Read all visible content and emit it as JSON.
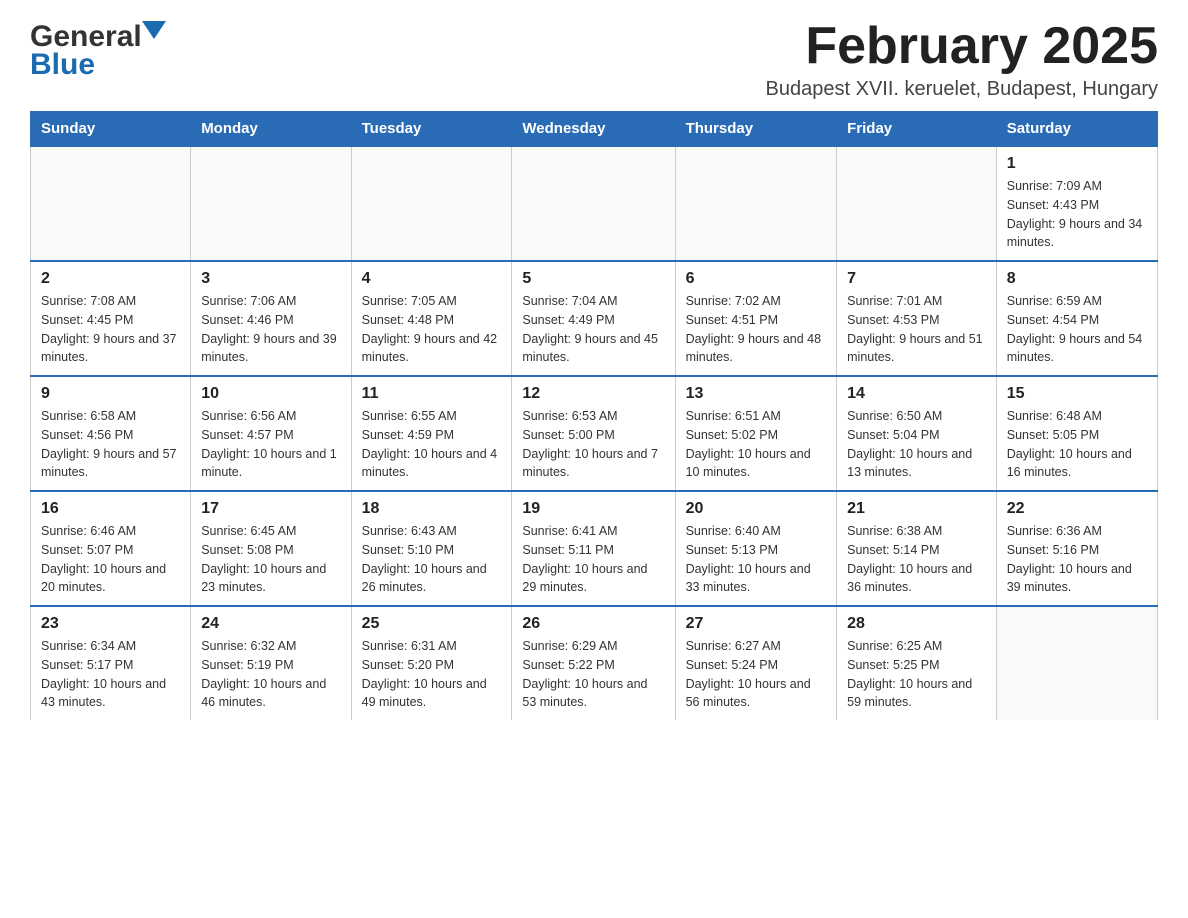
{
  "logo": {
    "general": "General",
    "blue": "Blue"
  },
  "header": {
    "month": "February 2025",
    "location": "Budapest XVII. keruelet, Budapest, Hungary"
  },
  "days_of_week": [
    "Sunday",
    "Monday",
    "Tuesday",
    "Wednesday",
    "Thursday",
    "Friday",
    "Saturday"
  ],
  "weeks": [
    [
      {
        "day": "",
        "sunrise": "",
        "sunset": "",
        "daylight": ""
      },
      {
        "day": "",
        "sunrise": "",
        "sunset": "",
        "daylight": ""
      },
      {
        "day": "",
        "sunrise": "",
        "sunset": "",
        "daylight": ""
      },
      {
        "day": "",
        "sunrise": "",
        "sunset": "",
        "daylight": ""
      },
      {
        "day": "",
        "sunrise": "",
        "sunset": "",
        "daylight": ""
      },
      {
        "day": "",
        "sunrise": "",
        "sunset": "",
        "daylight": ""
      },
      {
        "day": "1",
        "sunrise": "Sunrise: 7:09 AM",
        "sunset": "Sunset: 4:43 PM",
        "daylight": "Daylight: 9 hours and 34 minutes."
      }
    ],
    [
      {
        "day": "2",
        "sunrise": "Sunrise: 7:08 AM",
        "sunset": "Sunset: 4:45 PM",
        "daylight": "Daylight: 9 hours and 37 minutes."
      },
      {
        "day": "3",
        "sunrise": "Sunrise: 7:06 AM",
        "sunset": "Sunset: 4:46 PM",
        "daylight": "Daylight: 9 hours and 39 minutes."
      },
      {
        "day": "4",
        "sunrise": "Sunrise: 7:05 AM",
        "sunset": "Sunset: 4:48 PM",
        "daylight": "Daylight: 9 hours and 42 minutes."
      },
      {
        "day": "5",
        "sunrise": "Sunrise: 7:04 AM",
        "sunset": "Sunset: 4:49 PM",
        "daylight": "Daylight: 9 hours and 45 minutes."
      },
      {
        "day": "6",
        "sunrise": "Sunrise: 7:02 AM",
        "sunset": "Sunset: 4:51 PM",
        "daylight": "Daylight: 9 hours and 48 minutes."
      },
      {
        "day": "7",
        "sunrise": "Sunrise: 7:01 AM",
        "sunset": "Sunset: 4:53 PM",
        "daylight": "Daylight: 9 hours and 51 minutes."
      },
      {
        "day": "8",
        "sunrise": "Sunrise: 6:59 AM",
        "sunset": "Sunset: 4:54 PM",
        "daylight": "Daylight: 9 hours and 54 minutes."
      }
    ],
    [
      {
        "day": "9",
        "sunrise": "Sunrise: 6:58 AM",
        "sunset": "Sunset: 4:56 PM",
        "daylight": "Daylight: 9 hours and 57 minutes."
      },
      {
        "day": "10",
        "sunrise": "Sunrise: 6:56 AM",
        "sunset": "Sunset: 4:57 PM",
        "daylight": "Daylight: 10 hours and 1 minute."
      },
      {
        "day": "11",
        "sunrise": "Sunrise: 6:55 AM",
        "sunset": "Sunset: 4:59 PM",
        "daylight": "Daylight: 10 hours and 4 minutes."
      },
      {
        "day": "12",
        "sunrise": "Sunrise: 6:53 AM",
        "sunset": "Sunset: 5:00 PM",
        "daylight": "Daylight: 10 hours and 7 minutes."
      },
      {
        "day": "13",
        "sunrise": "Sunrise: 6:51 AM",
        "sunset": "Sunset: 5:02 PM",
        "daylight": "Daylight: 10 hours and 10 minutes."
      },
      {
        "day": "14",
        "sunrise": "Sunrise: 6:50 AM",
        "sunset": "Sunset: 5:04 PM",
        "daylight": "Daylight: 10 hours and 13 minutes."
      },
      {
        "day": "15",
        "sunrise": "Sunrise: 6:48 AM",
        "sunset": "Sunset: 5:05 PM",
        "daylight": "Daylight: 10 hours and 16 minutes."
      }
    ],
    [
      {
        "day": "16",
        "sunrise": "Sunrise: 6:46 AM",
        "sunset": "Sunset: 5:07 PM",
        "daylight": "Daylight: 10 hours and 20 minutes."
      },
      {
        "day": "17",
        "sunrise": "Sunrise: 6:45 AM",
        "sunset": "Sunset: 5:08 PM",
        "daylight": "Daylight: 10 hours and 23 minutes."
      },
      {
        "day": "18",
        "sunrise": "Sunrise: 6:43 AM",
        "sunset": "Sunset: 5:10 PM",
        "daylight": "Daylight: 10 hours and 26 minutes."
      },
      {
        "day": "19",
        "sunrise": "Sunrise: 6:41 AM",
        "sunset": "Sunset: 5:11 PM",
        "daylight": "Daylight: 10 hours and 29 minutes."
      },
      {
        "day": "20",
        "sunrise": "Sunrise: 6:40 AM",
        "sunset": "Sunset: 5:13 PM",
        "daylight": "Daylight: 10 hours and 33 minutes."
      },
      {
        "day": "21",
        "sunrise": "Sunrise: 6:38 AM",
        "sunset": "Sunset: 5:14 PM",
        "daylight": "Daylight: 10 hours and 36 minutes."
      },
      {
        "day": "22",
        "sunrise": "Sunrise: 6:36 AM",
        "sunset": "Sunset: 5:16 PM",
        "daylight": "Daylight: 10 hours and 39 minutes."
      }
    ],
    [
      {
        "day": "23",
        "sunrise": "Sunrise: 6:34 AM",
        "sunset": "Sunset: 5:17 PM",
        "daylight": "Daylight: 10 hours and 43 minutes."
      },
      {
        "day": "24",
        "sunrise": "Sunrise: 6:32 AM",
        "sunset": "Sunset: 5:19 PM",
        "daylight": "Daylight: 10 hours and 46 minutes."
      },
      {
        "day": "25",
        "sunrise": "Sunrise: 6:31 AM",
        "sunset": "Sunset: 5:20 PM",
        "daylight": "Daylight: 10 hours and 49 minutes."
      },
      {
        "day": "26",
        "sunrise": "Sunrise: 6:29 AM",
        "sunset": "Sunset: 5:22 PM",
        "daylight": "Daylight: 10 hours and 53 minutes."
      },
      {
        "day": "27",
        "sunrise": "Sunrise: 6:27 AM",
        "sunset": "Sunset: 5:24 PM",
        "daylight": "Daylight: 10 hours and 56 minutes."
      },
      {
        "day": "28",
        "sunrise": "Sunrise: 6:25 AM",
        "sunset": "Sunset: 5:25 PM",
        "daylight": "Daylight: 10 hours and 59 minutes."
      },
      {
        "day": "",
        "sunrise": "",
        "sunset": "",
        "daylight": ""
      }
    ]
  ]
}
